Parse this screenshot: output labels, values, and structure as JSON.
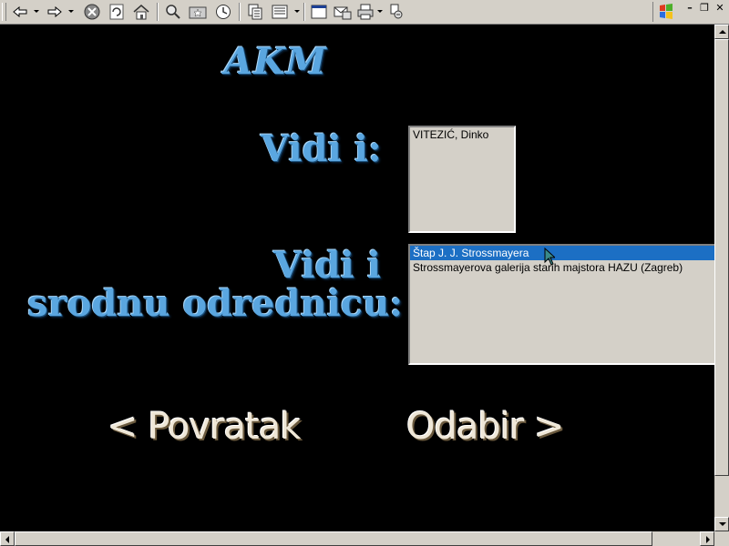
{
  "toolbar": {
    "buttons": [
      {
        "name": "back-icon"
      },
      {
        "name": "forward-icon"
      },
      {
        "name": "stop-icon"
      },
      {
        "name": "refresh-icon"
      },
      {
        "name": "home-icon"
      },
      {
        "name": "search-icon"
      },
      {
        "name": "favorites-icon"
      },
      {
        "name": "history-icon"
      },
      {
        "name": "copy-icon"
      },
      {
        "name": "edit-icon"
      },
      {
        "name": "fullscreen-icon"
      },
      {
        "name": "mail-icon"
      },
      {
        "name": "print-icon"
      },
      {
        "name": "translate-icon"
      }
    ],
    "window_controls": {
      "minimize": "–",
      "restore": "❐",
      "close": "✕"
    }
  },
  "header": {
    "title": "AKM"
  },
  "section_see_also": {
    "label": "Vidi i:",
    "items": [
      "VITEZIĆ, Dinko"
    ]
  },
  "section_related": {
    "label_line1": "Vidi i",
    "label_line2": "srodnu odrednicu:",
    "items": [
      "Štap J. J. Strossmayera",
      "Strossmayerova galerija starih majstora HAZU (Zagreb)"
    ],
    "selected_index": 0
  },
  "nav": {
    "back_label": "< Povratak",
    "select_label": "Odabir  >"
  },
  "colors": {
    "heading": "#5aa6e0",
    "selection": "#1c6fc4",
    "chrome": "#d4d0c8",
    "background": "#000000"
  }
}
